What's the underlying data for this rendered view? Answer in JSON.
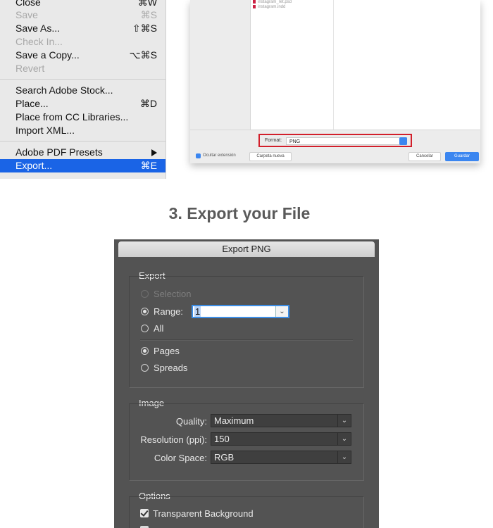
{
  "file_menu": {
    "items": [
      {
        "label": "Close",
        "shortcut": "⌘W",
        "disabled": false
      },
      {
        "label": "Save",
        "shortcut": "⌘S",
        "disabled": true
      },
      {
        "label": "Save As...",
        "shortcut": "⇧⌘S",
        "disabled": false
      },
      {
        "label": "Check In...",
        "shortcut": "",
        "disabled": true
      },
      {
        "label": "Save a Copy...",
        "shortcut": "⌥⌘S",
        "disabled": false
      },
      {
        "label": "Revert",
        "shortcut": "",
        "disabled": true
      },
      {
        "label": "Search Adobe Stock...",
        "shortcut": "",
        "disabled": false
      },
      {
        "label": "Place...",
        "shortcut": "⌘D",
        "disabled": false
      },
      {
        "label": "Place from CC Libraries...",
        "shortcut": "",
        "disabled": false
      },
      {
        "label": "Import XML...",
        "shortcut": "",
        "disabled": false
      },
      {
        "label": "Adobe PDF Presets",
        "shortcut": "",
        "disabled": false,
        "submenu": true
      },
      {
        "label": "Export...",
        "shortcut": "⌘E",
        "disabled": false,
        "selected": true
      }
    ]
  },
  "save_dialog": {
    "file_items": [
      "instagram_ret.psd",
      "instagram.indd"
    ],
    "format_label": "Format:",
    "format_value": "PNG",
    "hide_extension_label": "Ocultar extensión",
    "new_folder_label": "Carpeta nueva",
    "cancel_label": "Cancelar",
    "save_label": "Guardar"
  },
  "step_heading": "3. Export your File",
  "export_dialog": {
    "title": "Export PNG",
    "export_group": {
      "title": "Export",
      "selection_label": "Selection",
      "range_label": "Range:",
      "range_value": "1",
      "all_label": "All",
      "pages_label": "Pages",
      "spreads_label": "Spreads"
    },
    "image_group": {
      "title": "Image",
      "quality_label": "Quality:",
      "quality_value": "Maximum",
      "resolution_label": "Resolution (ppi):",
      "resolution_value": "150",
      "color_space_label": "Color Space:",
      "color_space_value": "RGB"
    },
    "options_group": {
      "title": "Options",
      "transparent_bg_label": "Transparent Background",
      "transparent_bg_checked": true
    }
  },
  "colors": {
    "menu_selection": "#1a64e6",
    "format_highlight": "#d21f2b",
    "dialog_bg": "#535353",
    "heading_text": "#5a5a5a"
  }
}
